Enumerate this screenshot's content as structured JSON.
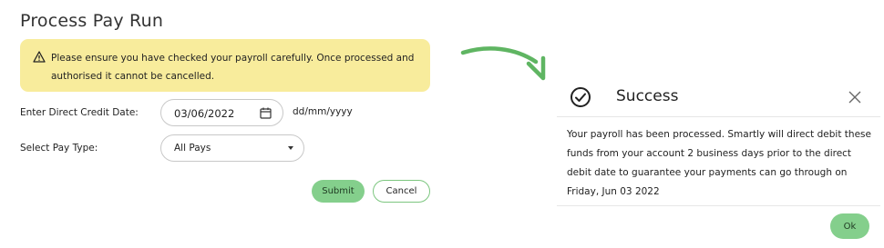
{
  "form": {
    "title": "Process Pay Run",
    "warning": {
      "icon": "warning-triangle-icon",
      "text": "Please ensure you have checked your payroll carefully. Once processed and authorised it cannot be cancelled."
    },
    "date_label": "Enter Direct Credit Date:",
    "date_value": "03/06/2022",
    "date_icon": "calendar-icon",
    "date_format_hint": "dd/mm/yyyy",
    "pay_type_label": "Select Pay Type:",
    "pay_type_value": "All Pays",
    "submit_label": "Submit",
    "cancel_label": "Cancel"
  },
  "modal": {
    "icon": "check-circle-icon",
    "title": "Success",
    "close_icon": "close-icon",
    "message": "Your payroll has been processed. Smartly will direct debit these funds from your account 2 business days prior to the direct debit date to guarantee your payments can go through on Friday, Jun 03 2022",
    "ok_label": "Ok"
  },
  "colors": {
    "warning_bg": "#f8ec9c",
    "accent_green": "#84cf8c",
    "arrow_green": "#5fb562"
  }
}
